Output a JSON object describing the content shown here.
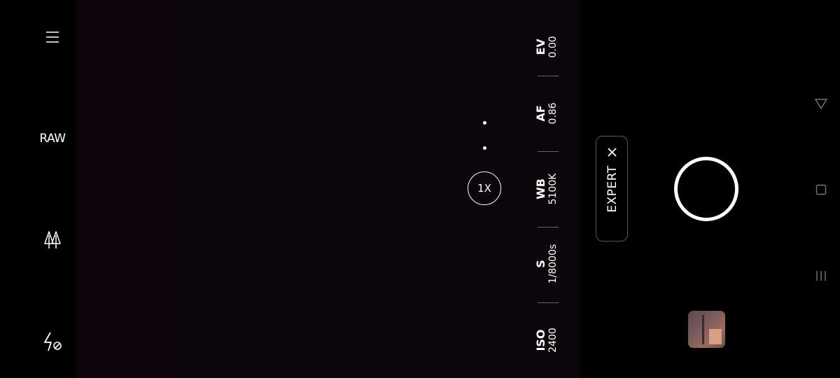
{
  "left_controls": {
    "menu_icon": "hamburger-menu-icon",
    "raw_label": "RAW",
    "scene_icon": "trees-scene-icon",
    "flash_icon": "flash-off-icon"
  },
  "viewfinder": {
    "zoom_label": "1X",
    "pagination_dots": 2
  },
  "params": [
    {
      "name": "EV",
      "value": "0.00"
    },
    {
      "name": "AF",
      "value": "0.86"
    },
    {
      "name": "WB",
      "value": "5100K"
    },
    {
      "name": "S",
      "value": "1/8000s"
    },
    {
      "name": "ISO",
      "value": "2400"
    }
  ],
  "mode": {
    "label": "EXPERT",
    "close_icon": "close-icon"
  },
  "shutter_icon": "shutter-button",
  "gallery_thumbnail": "gallery-thumbnail",
  "system_nav": {
    "back_icon": "back-triangle-icon",
    "home_icon": "home-square-icon",
    "recents_icon": "recents-lines-icon"
  },
  "colors": {
    "background": "#000000",
    "viewfinder": "#0b050b",
    "foreground": "#ffffff",
    "separator": "#666666"
  }
}
